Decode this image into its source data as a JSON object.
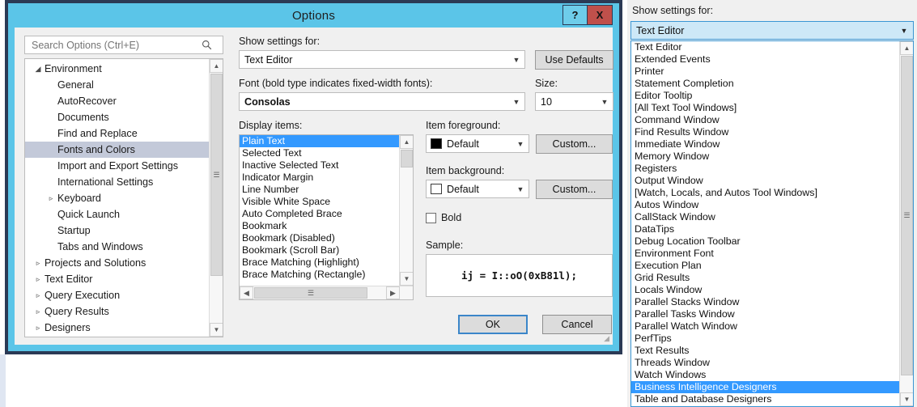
{
  "dialog": {
    "title": "Options",
    "help_button": "?",
    "close_button": "X"
  },
  "search": {
    "placeholder": "Search Options (Ctrl+E)",
    "value": "",
    "icon": "search-icon"
  },
  "tree": [
    {
      "label": "Environment",
      "level": 1,
      "twisty": "expanded",
      "selected": false
    },
    {
      "label": "General",
      "level": 2,
      "twisty": "none",
      "selected": false
    },
    {
      "label": "AutoRecover",
      "level": 2,
      "twisty": "none",
      "selected": false
    },
    {
      "label": "Documents",
      "level": 2,
      "twisty": "none",
      "selected": false
    },
    {
      "label": "Find and Replace",
      "level": 2,
      "twisty": "none",
      "selected": false
    },
    {
      "label": "Fonts and Colors",
      "level": 2,
      "twisty": "none",
      "selected": true
    },
    {
      "label": "Import and Export Settings",
      "level": 2,
      "twisty": "none",
      "selected": false
    },
    {
      "label": "International Settings",
      "level": 2,
      "twisty": "none",
      "selected": false
    },
    {
      "label": "Keyboard",
      "level": 2,
      "twisty": "collapsed",
      "selected": false
    },
    {
      "label": "Quick Launch",
      "level": 2,
      "twisty": "none",
      "selected": false
    },
    {
      "label": "Startup",
      "level": 2,
      "twisty": "none",
      "selected": false
    },
    {
      "label": "Tabs and Windows",
      "level": 2,
      "twisty": "none",
      "selected": false
    },
    {
      "label": "Projects and Solutions",
      "level": 1,
      "twisty": "collapsed",
      "selected": false
    },
    {
      "label": "Text Editor",
      "level": 1,
      "twisty": "collapsed",
      "selected": false
    },
    {
      "label": "Query Execution",
      "level": 1,
      "twisty": "collapsed",
      "selected": false
    },
    {
      "label": "Query Results",
      "level": 1,
      "twisty": "collapsed",
      "selected": false
    },
    {
      "label": "Designers",
      "level": 1,
      "twisty": "collapsed",
      "selected": false
    }
  ],
  "settings": {
    "show_settings_label": "Show settings for:",
    "show_settings_value": "Text Editor",
    "use_defaults_label": "Use Defaults",
    "font_label": "Font (bold type indicates fixed-width fonts):",
    "font_value": "Consolas",
    "size_label": "Size:",
    "size_value": "10",
    "display_items_label": "Display items:",
    "item_foreground_label": "Item foreground:",
    "item_foreground_value": "Default",
    "item_foreground_swatch": "#000000",
    "item_background_label": "Item background:",
    "item_background_value": "Default",
    "item_background_swatch": "#ffffff",
    "foreground_custom_label": "Custom...",
    "background_custom_label": "Custom...",
    "bold_label": "Bold",
    "bold_checked": false,
    "sample_label": "Sample:",
    "sample_text": "ij = I::oO(0xB81l);"
  },
  "display_items": [
    {
      "label": "Plain Text",
      "selected": true
    },
    {
      "label": "Selected Text",
      "selected": false
    },
    {
      "label": "Inactive Selected Text",
      "selected": false
    },
    {
      "label": "Indicator Margin",
      "selected": false
    },
    {
      "label": "Line Number",
      "selected": false
    },
    {
      "label": "Visible White Space",
      "selected": false
    },
    {
      "label": "Auto Completed Brace",
      "selected": false
    },
    {
      "label": "Bookmark",
      "selected": false
    },
    {
      "label": "Bookmark (Disabled)",
      "selected": false
    },
    {
      "label": "Bookmark (Scroll Bar)",
      "selected": false
    },
    {
      "label": "Brace Matching (Highlight)",
      "selected": false
    },
    {
      "label": "Brace Matching (Rectangle)",
      "selected": false
    }
  ],
  "footer": {
    "ok_label": "OK",
    "cancel_label": "Cancel"
  },
  "right_panel": {
    "label": "Show settings for:",
    "selected_value": "Text Editor",
    "options": [
      {
        "label": "Text Editor",
        "selected": false
      },
      {
        "label": "Extended Events",
        "selected": false
      },
      {
        "label": "Printer",
        "selected": false
      },
      {
        "label": "Statement Completion",
        "selected": false
      },
      {
        "label": "Editor Tooltip",
        "selected": false
      },
      {
        "label": "[All Text Tool Windows]",
        "selected": false
      },
      {
        "label": "Command Window",
        "selected": false
      },
      {
        "label": "Find Results Window",
        "selected": false
      },
      {
        "label": "Immediate Window",
        "selected": false
      },
      {
        "label": "Memory Window",
        "selected": false
      },
      {
        "label": "Registers",
        "selected": false
      },
      {
        "label": "Output Window",
        "selected": false
      },
      {
        "label": "[Watch, Locals, and Autos Tool Windows]",
        "selected": false
      },
      {
        "label": "Autos Window",
        "selected": false
      },
      {
        "label": "CallStack Window",
        "selected": false
      },
      {
        "label": "DataTips",
        "selected": false
      },
      {
        "label": "Debug Location Toolbar",
        "selected": false
      },
      {
        "label": "Environment Font",
        "selected": false
      },
      {
        "label": "Execution Plan",
        "selected": false
      },
      {
        "label": "Grid Results",
        "selected": false
      },
      {
        "label": "Locals Window",
        "selected": false
      },
      {
        "label": "Parallel Stacks Window",
        "selected": false
      },
      {
        "label": "Parallel Tasks Window",
        "selected": false
      },
      {
        "label": "Parallel Watch Window",
        "selected": false
      },
      {
        "label": "PerfTips",
        "selected": false
      },
      {
        "label": "Text Results",
        "selected": false
      },
      {
        "label": "Threads Window",
        "selected": false
      },
      {
        "label": "Watch Windows",
        "selected": false
      },
      {
        "label": "Business Intelligence Designers",
        "selected": true
      },
      {
        "label": "Table and Database Designers",
        "selected": false
      }
    ]
  },
  "colors": {
    "titlebar": "#5bc5e8",
    "frame": "#2b3a55",
    "selection": "#3399ff",
    "close_button": "#c0504b",
    "dialog_bg": "#f0f0f0"
  }
}
